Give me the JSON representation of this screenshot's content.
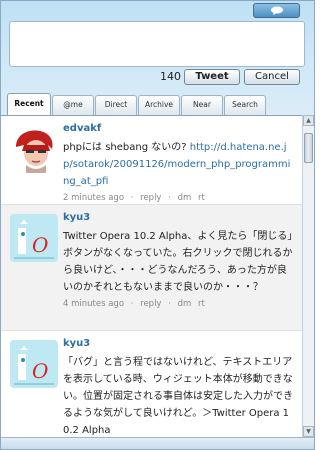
{
  "compose": {
    "char_count": "140",
    "tweet_label": "Tweet",
    "cancel_label": "Cancel"
  },
  "tabs": [
    {
      "label": "Recent"
    },
    {
      "label": "@me"
    },
    {
      "label": "Direct"
    },
    {
      "label": "Archive"
    },
    {
      "label": "Near"
    },
    {
      "label": "Search"
    }
  ],
  "statuses": [
    {
      "user": "edvakf",
      "text_prefix": "phpには shebang ないの? ",
      "link": "http://d.hatena.ne.jp/sotarok/20091126/modern_php_programming_at_pfi",
      "time": "2 minutes ago",
      "reply": "reply",
      "dm": "dm",
      "rt": "rt"
    },
    {
      "user": "kyu3",
      "text": "Twitter Opera 10.2 Alpha、よく見たら「閉じる」ボタンがなくなっていた。右クリックで閉じれるから良いけど、・・・どうなんだろう、あった方が良いのかそれともないままで良いのか・・・？",
      "time": "4 minutes ago",
      "reply": "reply",
      "dm": "dm",
      "rt": "rt"
    },
    {
      "user": "kyu3",
      "text": "「バグ」と言う程ではないけれど、テキストエリアを表示している時、ウィジェット本体が移動できない。位置が固定される事自体は安定した入力ができるような気がして良いけれど。＞Twitter Opera 10.2 Alpha"
    }
  ],
  "colors": {
    "link": "#2a6fa5",
    "header_bg": "#cfe8f7",
    "alt_row": "#f2f2f2"
  }
}
